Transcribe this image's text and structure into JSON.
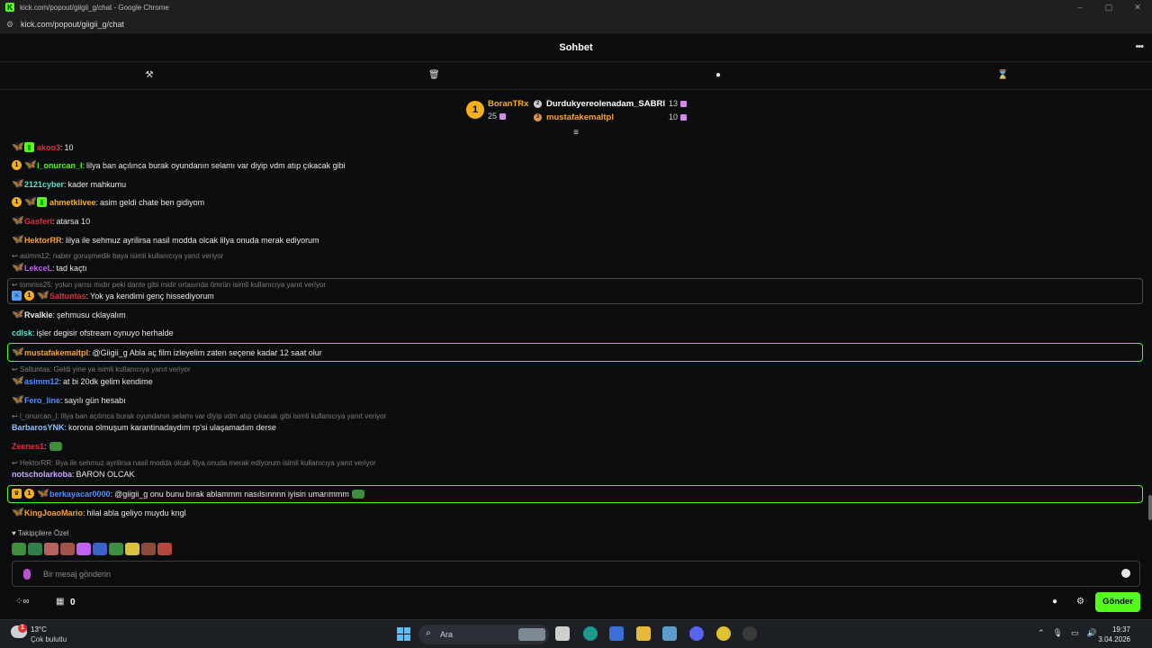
{
  "window": {
    "title": "kick.com/popout/giigii_g/chat - Google Chrome",
    "url": "kick.com/popout/giigii_g/chat",
    "controls": [
      "–",
      "▢",
      "✕"
    ]
  },
  "header": {
    "title": "Sohbet",
    "more": "•••"
  },
  "toolbar": [
    "hammer-icon",
    "trash-icon",
    "chat-bubble-icon",
    "hourglass-icon"
  ],
  "leaderboard": {
    "first": {
      "rank": "1",
      "name": "BoranTRx",
      "score": "25",
      "color": "#f5b019"
    },
    "second": {
      "name": "Durdukyereolenadam_SABRI",
      "score": "13",
      "color": "#ffffff"
    },
    "third": {
      "name": "mustafakemaltpl",
      "score": "10",
      "color": "#f5a23a"
    }
  },
  "messages": [
    {
      "user": "akoo3",
      "text": "10",
      "color": "#e0303f"
    },
    {
      "user": "l_onurcan_l",
      "text": "lilya ban açılınca burak oyundanın selamı var diyip vdm atıp çıkacak gibi",
      "color": "#53fc18"
    },
    {
      "user": "2121cyber",
      "text": "kader mahkumu",
      "color": "#5fe0c8"
    },
    {
      "user": "ahmetklivee",
      "text": "asim geldi chate ben gidiyom",
      "color": "#f5b019"
    },
    {
      "user": "Gasferi",
      "text": "atarsa 10",
      "color": "#e0303f"
    },
    {
      "user": "HektorRR",
      "text": "lilya ile sehmuz ayrilirsa nasil modda olcak lilya onuda merak ediyorum",
      "color": "#f5a23a"
    },
    {
      "reply": "asimm12: naber goruşmedik baya isimli kullanıcıya yanıt veriyor",
      "user": "LekceL",
      "text": "tad kaçtı",
      "color": "#c063f0"
    },
    {
      "reply": "tomriss25: yolun yarısı mıdır peki dante gibi midir ortasında ömrün isimli kullanıcıya yanıt veriyor",
      "user": "Saltuntas",
      "text": "Yok ya kendimi genç hissediyorum",
      "color": "#e0303f"
    },
    {
      "user": "Rvalkie",
      "text": "şehmusu cklayalım",
      "color": "#e9e9e9"
    },
    {
      "user": "cdlsk",
      "text": "işler degisir ofstream oynuyo herhalde",
      "color": "#5fe0c8"
    },
    {
      "user": "mustafakemaltpl",
      "text": "@Giigii_g Abla aç film izleyelim zaten seçene kadar 12 saat olur",
      "color": "#f5a23a"
    },
    {
      "reply": "Saltuntas: Geldi yine ya isimli kullanıcıya yanıt veriyor",
      "user": "asimm12",
      "text": "at bi 20dk gelim kendime",
      "color": "#4f8fff"
    },
    {
      "user": "Fero_line",
      "text": "sayılı gün hesabı",
      "color": "#4f8fff"
    },
    {
      "reply": "l_onurcan_l: lilya ban açılınca burak oyundanın selamı var diyip vdm atıp çıkacak gibi isimli kullanıcıya yanıt veriyor",
      "user": "BarbarosYNK",
      "text": "korona olmuşum karantinadaydım rp'si ulaşamadım derse",
      "color": "#8fc1ff"
    },
    {
      "user": "Zeenes1",
      "text": "",
      "color": "#e0303f"
    },
    {
      "reply": "HektorRR: lilya ile sehmuz ayrilirsa nasil modda olcak lilya onuda merak ediyorum isimli kullanıcıya yanıt veriyor",
      "user": "notscholarkoba",
      "text": "BARON OLCAK",
      "color": "#c9a8ff"
    },
    {
      "user": "berkayacar0000",
      "text": "@giigii_g onu bunu bırak ablammm nasılsınnnn iyisin umarımmm",
      "color": "#4f8fff"
    },
    {
      "user": "KingJoaoMario",
      "text": "hilal abla geliyo muydu kngl",
      "color": "#f5a23a"
    }
  ],
  "followers_label": "Takipçilere Özel",
  "input": {
    "placeholder": "Bir mesaj gönderin"
  },
  "bottom": {
    "count": "0",
    "send": "Gönder"
  },
  "taskbar": {
    "temp": "13°C",
    "condition": "Çok bulutlu",
    "search": "Ara",
    "time": "19:37",
    "date": "3.04.2026",
    "notif": "1"
  },
  "colors": {
    "accent": "#53fc18",
    "background": "#0b0d0e"
  }
}
